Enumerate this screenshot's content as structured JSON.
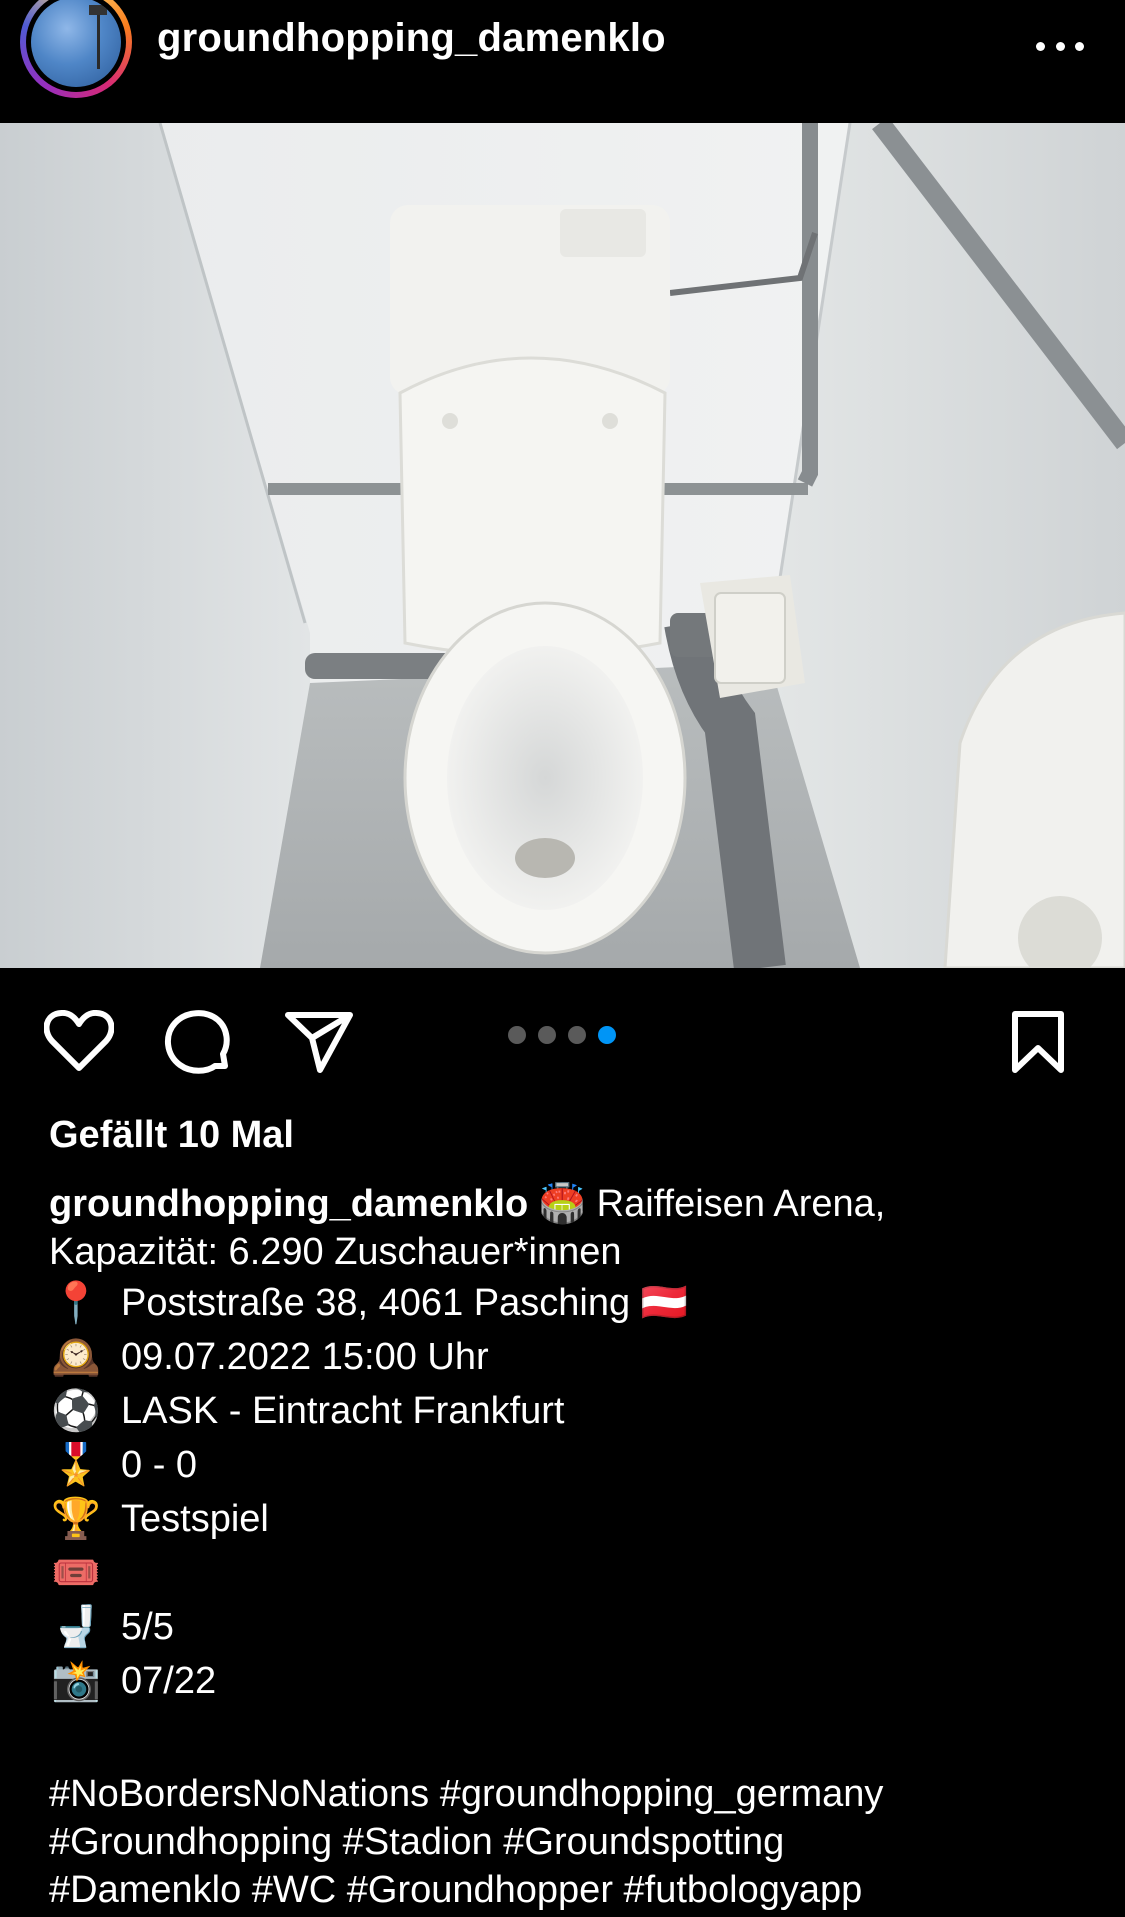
{
  "header": {
    "username": "groundhopping_damenklo",
    "more_icon": "more-horizontal-icon"
  },
  "post": {
    "image_description_icon": "photo",
    "carousel": {
      "count": 4,
      "active_index": 3
    },
    "likes_text": "Gefällt 10 Mal",
    "caption": {
      "username": "groundhopping_damenklo",
      "stadium_emoji": "🏟️",
      "first_line_rest": "Raiffeisen Arena,",
      "second_line": "Kapazität: 6.290 Zuschauer*innen",
      "lines": [
        {
          "emoji": "📍",
          "text": "Poststraße 38, 4061 Pasching 🇦🇹"
        },
        {
          "emoji": "🕰️",
          "text": "09.07.2022 15:00 Uhr"
        },
        {
          "emoji": "⚽",
          "text": "LASK - Eintracht Frankfurt"
        },
        {
          "emoji": "🎖️",
          "text": "0 - 0"
        },
        {
          "emoji": "🏆",
          "text": "Testspiel"
        },
        {
          "emoji": "🎟️",
          "text": ""
        },
        {
          "emoji": "🚽",
          "text": "5/5"
        },
        {
          "emoji": "📸",
          "text": "07/22"
        }
      ]
    },
    "hashtag_lines": [
      "#NoBordersNoNations #groundhopping_germany",
      "#Groundhopping #Stadion #Groundspotting",
      "#Damenklo #WC #Groundhopper #futbologyapp"
    ]
  },
  "actions": {
    "like_icon": "heart-icon",
    "comment_icon": "comment-icon",
    "share_icon": "send-icon",
    "save_icon": "bookmark-icon"
  },
  "colors": {
    "background": "#000000",
    "text": "#ffffff",
    "carousel_active": "#0095f6",
    "carousel_inactive": "#5a5a5a"
  }
}
